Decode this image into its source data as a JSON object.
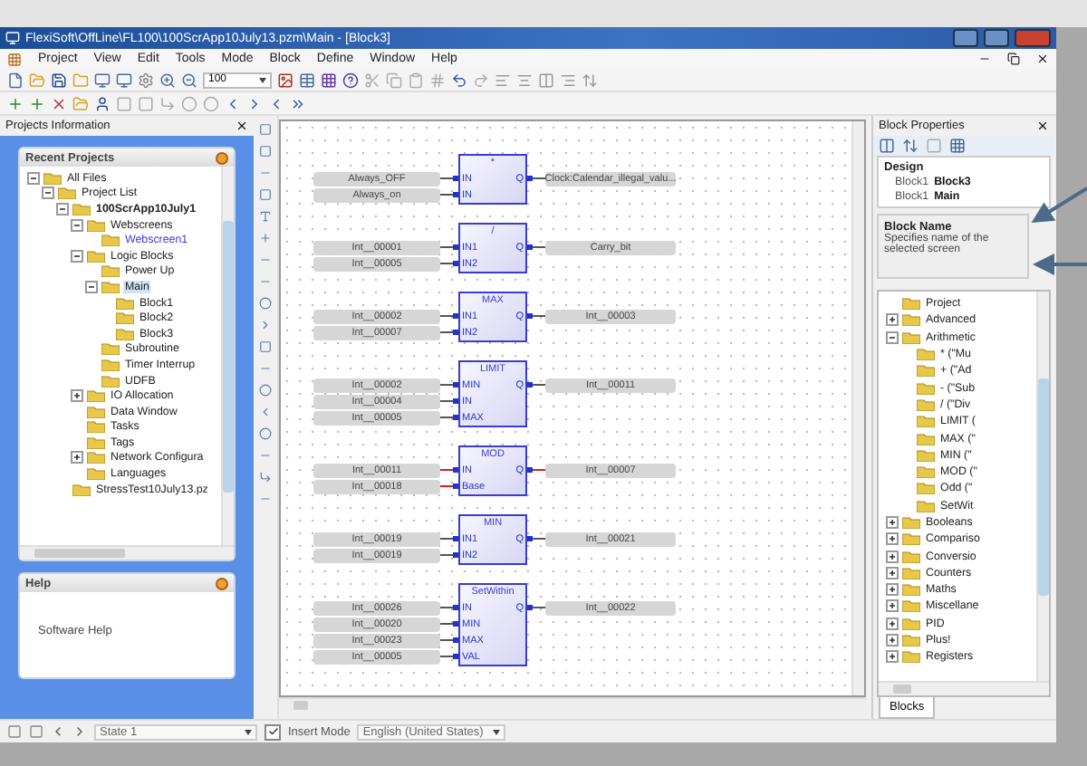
{
  "window": {
    "title": "FlexiSoft\\OffLine\\FL100\\100ScrApp10July13.pzm\\Main - [Block3]"
  },
  "menu": [
    "Project",
    "View",
    "Edit",
    "Tools",
    "Mode",
    "Block",
    "Define",
    "Window",
    "Help"
  ],
  "zoom": {
    "value": "100"
  },
  "projects_panel": {
    "title": "Projects Information",
    "recent_title": "Recent Projects",
    "tree": [
      {
        "label": "All Files",
        "expanded": true,
        "children": [
          {
            "label": "Project List",
            "expanded": true,
            "children": [
              {
                "label": "100ScrApp10July1",
                "bold": true,
                "expanded": true,
                "children": [
                  {
                    "label": "Webscreens",
                    "expanded": true,
                    "children": [
                      {
                        "label": "Webscreen1",
                        "color": "#3b3bd9"
                      }
                    ]
                  },
                  {
                    "label": "Logic Blocks",
                    "expanded": true,
                    "children": [
                      {
                        "label": "Power Up"
                      },
                      {
                        "label": "Main",
                        "expanded": true,
                        "selected": true,
                        "children": [
                          {
                            "label": "Block1",
                            "selected": false
                          },
                          {
                            "label": "Block2",
                            "selected": false
                          },
                          {
                            "label": "Block3",
                            "selected": false
                          }
                        ]
                      },
                      {
                        "label": "Subroutine"
                      },
                      {
                        "label": "Timer Interrup"
                      },
                      {
                        "label": "UDFB"
                      }
                    ]
                  },
                  {
                    "label": "IO Allocation",
                    "expanded": false
                  },
                  {
                    "label": "Data Window"
                  },
                  {
                    "label": "Tasks"
                  },
                  {
                    "label": "Tags"
                  },
                  {
                    "label": "Network Configura",
                    "expanded": false
                  },
                  {
                    "label": "Languages"
                  }
                ]
              },
              {
                "label": "StressTest10July13.pz"
              }
            ]
          }
        ]
      }
    ]
  },
  "help_panel": {
    "title": "Help",
    "text": "Software Help"
  },
  "diagram": {
    "blocks": [
      {
        "title": "*",
        "error": false,
        "inputs": [
          {
            "pin": "IN",
            "label": "Always_OFF"
          },
          {
            "pin": "IN",
            "label": "Always_on"
          }
        ],
        "output": {
          "pin": "Q",
          "label": "Clock:Calendar_illegal_valu..."
        }
      },
      {
        "title": "/",
        "error": false,
        "inputs": [
          {
            "pin": "IN1",
            "label": "Int__00001"
          },
          {
            "pin": "IN2",
            "label": "Int__00005"
          }
        ],
        "output": {
          "pin": "Q",
          "label": "Carry_bit"
        }
      },
      {
        "title": "MAX",
        "error": false,
        "inputs": [
          {
            "pin": "IN1",
            "label": "Int__00002"
          },
          {
            "pin": "IN2",
            "label": "Int__00007"
          }
        ],
        "output": {
          "pin": "Q",
          "label": "Int__00003"
        }
      },
      {
        "title": "LIMIT",
        "error": false,
        "inputs": [
          {
            "pin": "MIN",
            "label": "Int__00002"
          },
          {
            "pin": "IN",
            "label": "Int__00004"
          },
          {
            "pin": "MAX",
            "label": "Int__00005"
          }
        ],
        "output": {
          "pin": "Q",
          "label": "Int__00011"
        }
      },
      {
        "title": "MOD",
        "error": true,
        "inputs": [
          {
            "pin": "IN",
            "label": "Int__00011"
          },
          {
            "pin": "Base",
            "label": "Int__00018"
          }
        ],
        "output": {
          "pin": "Q",
          "label": "Int__00007"
        }
      },
      {
        "title": "MIN",
        "error": false,
        "inputs": [
          {
            "pin": "IN1",
            "label": "Int__00019"
          },
          {
            "pin": "IN2",
            "label": "Int__00019"
          }
        ],
        "output": {
          "pin": "Q",
          "label": "Int__00021"
        }
      },
      {
        "title": "SetWithin",
        "error": false,
        "inputs": [
          {
            "pin": "IN",
            "label": "Int__00026"
          },
          {
            "pin": "MIN",
            "label": "Int__00020"
          },
          {
            "pin": "MAX",
            "label": "Int__00023"
          },
          {
            "pin": "VAL",
            "label": "Int__00005"
          }
        ],
        "output": {
          "pin": "Q",
          "label": "Int__00022"
        }
      }
    ]
  },
  "properties": {
    "title": "Block Properties",
    "category": "Design",
    "rows": [
      {
        "name": "Block1",
        "value": "Block3"
      },
      {
        "name": "Block1",
        "value": "Main"
      }
    ],
    "description_title": "Block Name",
    "description": "Specifies name of the selected screen"
  },
  "blocks_tree": [
    {
      "label": "Project"
    },
    {
      "label": "Advanced",
      "expanded": false
    },
    {
      "label": "Arithmetic",
      "expanded": true,
      "children": [
        {
          "label": "* (\"Mu"
        },
        {
          "label": "+ (\"Ad"
        },
        {
          "label": "- (\"Sub"
        },
        {
          "label": "/ (\"Div"
        },
        {
          "label": "LIMIT ("
        },
        {
          "label": "MAX (\""
        },
        {
          "label": "MIN (\""
        },
        {
          "label": "MOD (\""
        },
        {
          "label": "Odd (\""
        },
        {
          "label": "SetWit"
        }
      ]
    },
    {
      "label": "Booleans",
      "expanded": false
    },
    {
      "label": "Compariso",
      "expanded": false
    },
    {
      "label": "Conversio",
      "expanded": false
    },
    {
      "label": "Counters",
      "expanded": false
    },
    {
      "label": "Maths",
      "expanded": false
    },
    {
      "label": "Miscellane",
      "expanded": false
    },
    {
      "label": "PID",
      "expanded": false
    },
    {
      "label": "Plus!",
      "expanded": false
    },
    {
      "label": "Registers",
      "expanded": false
    }
  ],
  "bottom_tabs": [
    {
      "label": "Blocks",
      "selected": true
    }
  ],
  "status_bar": {
    "state": "State 1",
    "insert_mode": {
      "label": "Insert Mode",
      "checked": true
    },
    "language": "English (United States)"
  }
}
